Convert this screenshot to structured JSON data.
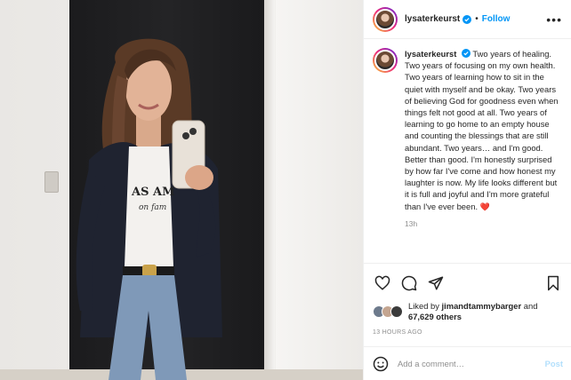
{
  "post": {
    "username": "lysaterkeurst",
    "follow_label": "Follow",
    "separator": "•",
    "more_label": "•••",
    "caption": "Two years of healing. Two years of focusing on my own health. Two years of learning how to sit in the quiet with myself and be okay. Two years of believing God for goodness even when things felt not good at all. Two years of learning to go home to an empty house and counting the blessings that are still abundant. Two years… and I'm good. Better than good. I'm honestly surprised by how far I've come and how honest my laughter is now. My life looks different but it is full and joyful and I'm more grateful than I've ever been.",
    "caption_emoji": "❤️",
    "caption_time": "13h",
    "liked_by_prefix": "Liked by",
    "liked_by_user": "jimandtammybarger",
    "liked_by_and": "and",
    "others_count": "67,629 others",
    "time_ago": "13 HOURS AGO"
  },
  "comment": {
    "placeholder": "Add a comment…",
    "post_label": "Post"
  },
  "icons": {
    "verified": "verified-badge-icon",
    "like": "heart-icon",
    "comment": "comment-icon",
    "share": "paper-plane-icon",
    "save": "bookmark-icon",
    "emoji": "smiley-icon"
  },
  "colors": {
    "link_blue": "#0095f6",
    "post_disabled": "#b2dffc",
    "muted": "#8e8e8e",
    "text": "#262626",
    "heart_red": "#ed4956"
  }
}
